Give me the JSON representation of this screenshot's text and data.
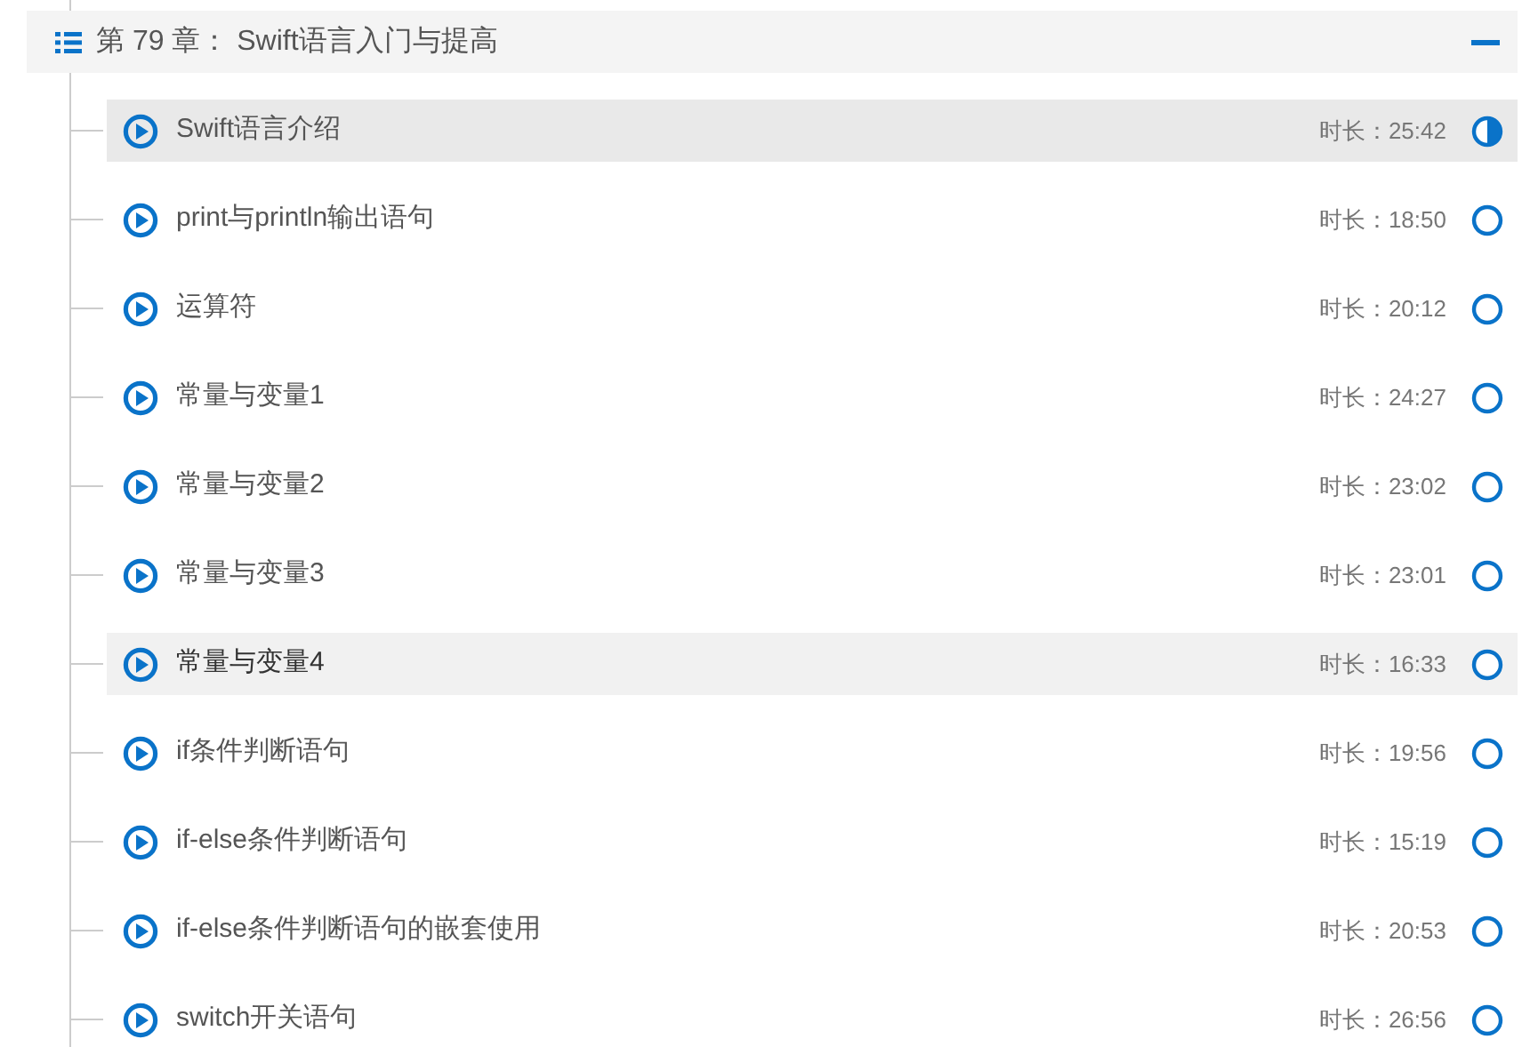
{
  "chapter": {
    "title": "第 79 章： Swift语言入门与提高",
    "expanded": true
  },
  "lessons": [
    {
      "title": "Swift语言介绍",
      "duration": "时长：25:42",
      "in_progress": true,
      "selected": true,
      "hovered": false
    },
    {
      "title": "print与println输出语句",
      "duration": "时长：18:50",
      "in_progress": false,
      "selected": false,
      "hovered": false
    },
    {
      "title": "运算符",
      "duration": "时长：20:12",
      "in_progress": false,
      "selected": false,
      "hovered": false
    },
    {
      "title": "常量与变量1",
      "duration": "时长：24:27",
      "in_progress": false,
      "selected": false,
      "hovered": false
    },
    {
      "title": "常量与变量2",
      "duration": "时长：23:02",
      "in_progress": false,
      "selected": false,
      "hovered": false
    },
    {
      "title": "常量与变量3",
      "duration": "时长：23:01",
      "in_progress": false,
      "selected": false,
      "hovered": false
    },
    {
      "title": "常量与变量4",
      "duration": "时长：16:33",
      "in_progress": false,
      "selected": false,
      "hovered": true
    },
    {
      "title": "if条件判断语句",
      "duration": "时长：19:56",
      "in_progress": false,
      "selected": false,
      "hovered": false
    },
    {
      "title": "if-else条件判断语句",
      "duration": "时长：15:19",
      "in_progress": false,
      "selected": false,
      "hovered": false
    },
    {
      "title": "if-else条件判断语句的嵌套使用",
      "duration": "时长：20:53",
      "in_progress": false,
      "selected": false,
      "hovered": false
    },
    {
      "title": "switch开关语句",
      "duration": "时长：26:56",
      "in_progress": false,
      "selected": false,
      "hovered": false
    }
  ]
}
